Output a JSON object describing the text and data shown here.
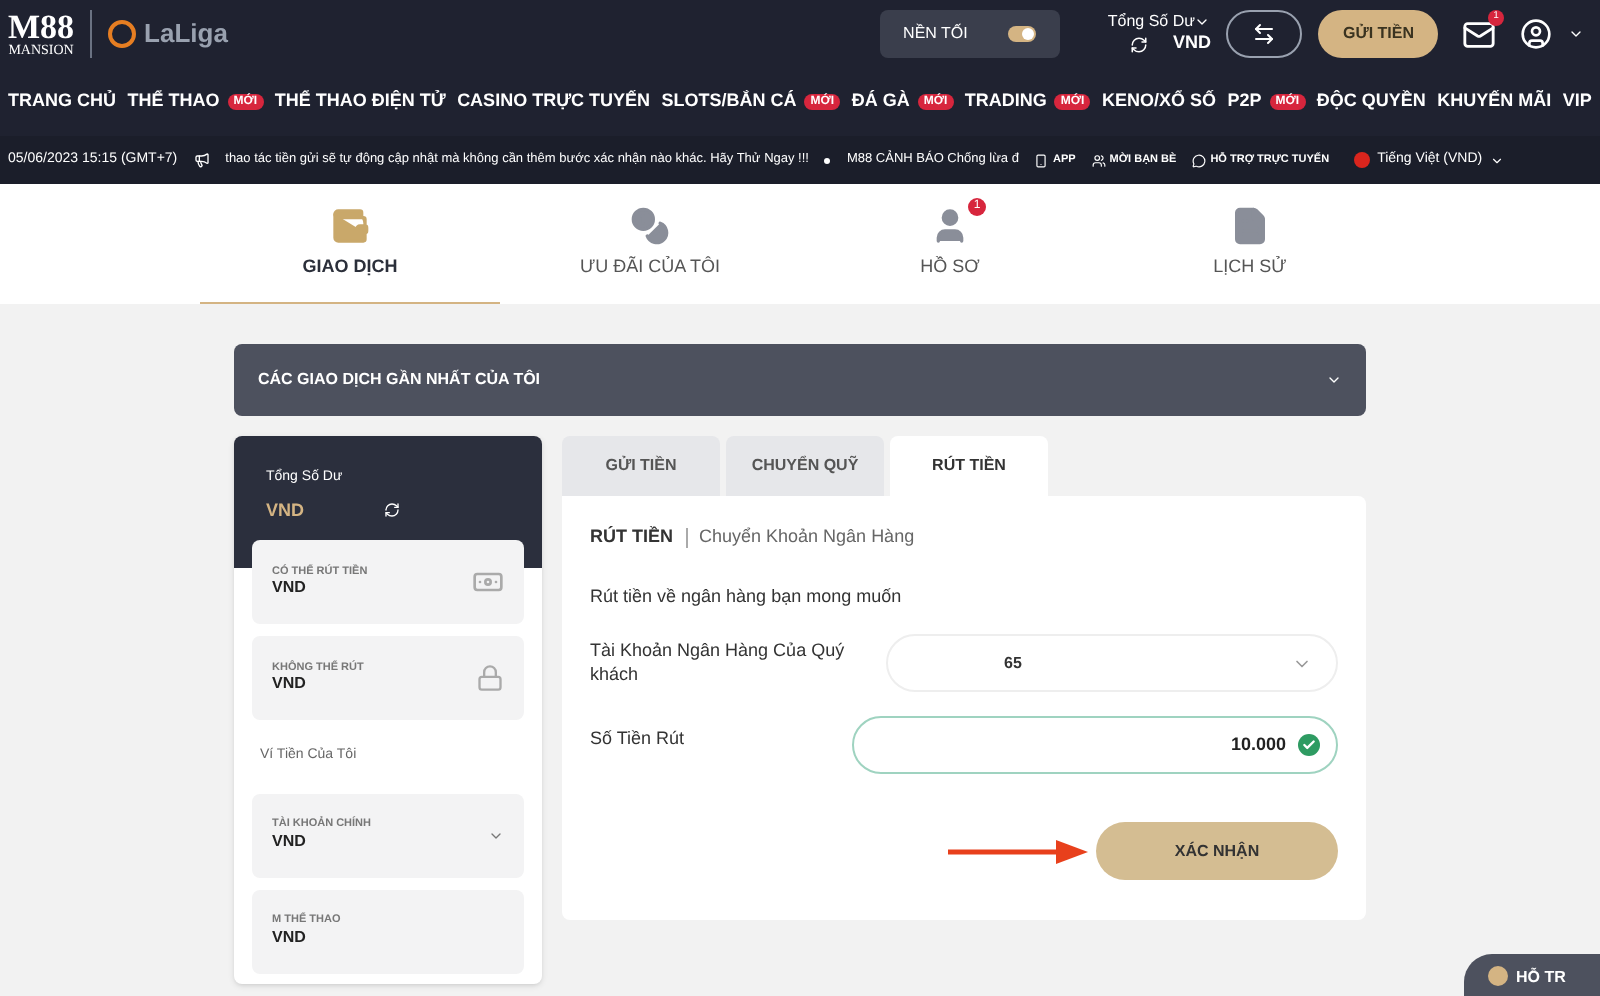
{
  "header": {
    "logo": {
      "mark": "M88",
      "sub": "MANSION"
    },
    "partner": "LaLiga",
    "dark_mode": {
      "label": "NỀN TỐI",
      "on": true
    },
    "balance": {
      "label": "Tổng Số Dư",
      "value": "VND"
    },
    "deposit_button": "GỬI TIỀN",
    "mail_badge": "1"
  },
  "nav": [
    {
      "label": "TRANG CHỦ"
    },
    {
      "label": "THỂ THAO",
      "badge": "MỚI"
    },
    {
      "label": "THỂ THAO ĐIỆN TỬ"
    },
    {
      "label": "CASINO TRỰC TUYẾN"
    },
    {
      "label": "SLOTS/BẮN CÁ",
      "badge": "MỚI"
    },
    {
      "label": "ĐÁ GÀ",
      "badge": "MỚI"
    },
    {
      "label": "TRADING",
      "badge": "MỚI"
    },
    {
      "label": "KENO/XỔ SỐ"
    },
    {
      "label": "P2P",
      "badge": "MỚI"
    },
    {
      "label": "ĐỘC QUYỀN"
    },
    {
      "label": "KHUYẾN MÃI"
    },
    {
      "label": "VIP"
    }
  ],
  "ticker": {
    "datetime": "05/06/2023 15:15 (GMT+7)",
    "messages": [
      "thao tác tiền gửi sẽ tự động cập nhật mà không cần thêm bước xác nhận nào khác. Hãy Thử Ngay !!!",
      "M88 CẢNH BÁO Chống lừa đ"
    ],
    "links": [
      {
        "kind": "app",
        "label": "APP"
      },
      {
        "kind": "invite",
        "label": "MỜI BẠN BÈ"
      },
      {
        "kind": "support",
        "label": "HỖ TRỢ TRỰC TUYẾN"
      }
    ],
    "language": "Tiếng Việt (VND)"
  },
  "account_tabs": [
    {
      "kind": "wallet",
      "label": "GIAO DỊCH",
      "selected": true
    },
    {
      "kind": "coins",
      "label": "ƯU ĐÃI CỦA TÔI",
      "selected": false
    },
    {
      "kind": "profile",
      "label": "HỒ SƠ",
      "selected": false,
      "badge": "1"
    },
    {
      "kind": "document",
      "label": "LỊCH SỬ",
      "selected": false
    }
  ],
  "recent_transactions": {
    "title": "CÁC GIAO DỊCH GẦN NHẤT CỦA TÔI",
    "expanded": false
  },
  "sidebar": {
    "total_label": "Tổng Số Dư",
    "total_value": "VND",
    "balances": [
      {
        "kind": "withdrawable",
        "label": "CÓ THỂ RÚT TIỀN",
        "value": "VND"
      },
      {
        "kind": "locked",
        "label": "KHÔNG THỂ RÚT",
        "value": "VND"
      }
    ],
    "wallets_title": "Ví Tiền Của Tôi",
    "wallets": [
      {
        "label": "TÀI KHOẢN CHÍNH",
        "value": "VND",
        "expandable": true
      },
      {
        "label": "M THỂ THAO",
        "value": "VND",
        "expandable": false
      }
    ]
  },
  "transfer_tabs": [
    {
      "label": "GỬI TIỀN",
      "selected": false
    },
    {
      "label": "CHUYỂN QUỸ",
      "selected": false
    },
    {
      "label": "RÚT TIỀN",
      "selected": true
    }
  ],
  "form": {
    "title": "RÚT TIỀN",
    "method": "Chuyển Khoản Ngân Hàng",
    "description": "Rút tiền về ngân hàng bạn mong muốn",
    "bank_account": {
      "label": "Tài Khoản Ngân Hàng Của Quý khách",
      "value": "65"
    },
    "amount": {
      "label": "Số Tiền Rút",
      "value": "10.000",
      "valid": true
    },
    "submit": "XÁC NHẬN"
  },
  "chat_button": "HỖ TR"
}
